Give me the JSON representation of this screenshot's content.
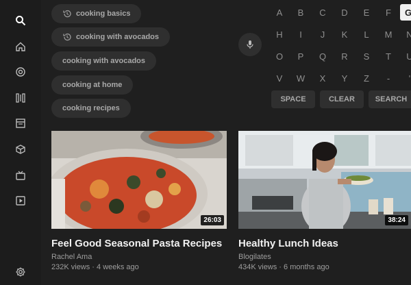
{
  "rail": {
    "icons": [
      "search-icon",
      "home-icon",
      "explore-icon",
      "subscriptions-icon",
      "library-icon",
      "cube-icon",
      "tv-icon",
      "play-box-icon",
      "settings-icon"
    ]
  },
  "suggestions": [
    {
      "label": "cooking basics",
      "history": true
    },
    {
      "label": "cooking with avocados",
      "history": true
    },
    {
      "label": "cooking with avocados",
      "history": false
    },
    {
      "label": "cooking at home",
      "history": false
    },
    {
      "label": "cooking recipes",
      "history": false
    }
  ],
  "keyboard": {
    "rows": [
      [
        "A",
        "B",
        "C",
        "D",
        "E",
        "F",
        "G"
      ],
      [
        "H",
        "I",
        "J",
        "K",
        "L",
        "M",
        "N"
      ],
      [
        "O",
        "P",
        "Q",
        "R",
        "S",
        "T",
        "U"
      ],
      [
        "V",
        "W",
        "X",
        "Y",
        "Z",
        "-",
        "'"
      ]
    ],
    "active_key": "G",
    "space_label": "SPACE",
    "clear_label": "CLEAR",
    "search_label": "SEARCH"
  },
  "videos": [
    {
      "title": "Feel Good Seasonal Pasta Recipes",
      "channel": "Rachel Ama",
      "meta": "232K views · 4 weeks ago",
      "duration": "26:03"
    },
    {
      "title": "Healthy Lunch Ideas",
      "channel": "Blogilates",
      "meta": "434K views · 6 months ago",
      "duration": "38:24"
    }
  ]
}
